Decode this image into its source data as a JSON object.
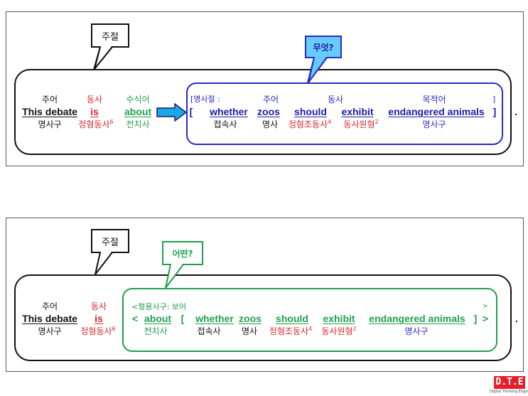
{
  "colors": {
    "black": "#111111",
    "red": "#d9262c",
    "green": "#1fa14b",
    "blue": "#2a2ac4",
    "callout_blue_fill": "#66ccff",
    "arrow_fill": "#1aa7e8",
    "logo_red": "#e3202a"
  },
  "panel1": {
    "callout_main": "주절",
    "callout_question": "무엇?",
    "main": [
      {
        "top": "주어",
        "word": "This debate",
        "bottom": "명사구",
        "color": "black"
      },
      {
        "top": "동사",
        "word": "is",
        "bottom": "정형동사",
        "bottom_sup": "6",
        "color": "red"
      },
      {
        "top": "수식어",
        "word": "about",
        "bottom": "전치사",
        "color": "green"
      }
    ],
    "arrow_icon": "right-arrow-icon",
    "clause_header": "[명사절 :",
    "clause_header_end": "]",
    "clause_open": "[",
    "clause_close": "]",
    "clause": [
      {
        "top": "",
        "word": "whether",
        "bottom": "접속사",
        "bottom_color": "black"
      },
      {
        "top": "주어",
        "word": "zoos",
        "bottom": "명사",
        "bottom_color": "black"
      },
      {
        "top": "",
        "word": "should",
        "bottom": "정형조동사",
        "bottom_sup": "4",
        "bottom_color": "red"
      },
      {
        "top": "동사",
        "word": "exhibit",
        "bottom": "동사원형",
        "bottom_sup": "2",
        "bottom_color": "red"
      },
      {
        "top": "목적어",
        "word": "endangered animals",
        "bottom": "명사구",
        "bottom_color": "blue"
      }
    ],
    "period": "."
  },
  "panel2": {
    "callout_main": "주절",
    "callout_question": "어떤?",
    "main": [
      {
        "top": "주어",
        "word": "This debate",
        "bottom": "명사구",
        "color": "black"
      },
      {
        "top": "동사",
        "word": "is",
        "bottom": "정형동사",
        "bottom_sup": "6",
        "color": "red"
      }
    ],
    "phrase_header": "<형용사구: 보어",
    "phrase_header_end": ">",
    "phrase_open": "<",
    "phrase_close": ">",
    "bracket_open": "[",
    "bracket_close": "]",
    "phrase": [
      {
        "word": "about",
        "bottom": "전치사",
        "bottom_color": "green"
      },
      {
        "word": "whether",
        "bottom": "접속사",
        "bottom_color": "black"
      },
      {
        "word": "zoos",
        "bottom": "명사",
        "bottom_color": "black"
      },
      {
        "word": "should",
        "bottom": "정형조동사",
        "bottom_sup": "4",
        "bottom_color": "red"
      },
      {
        "word": "exhibit",
        "bottom": "동사원형",
        "bottom_sup": "2",
        "bottom_color": "red"
      },
      {
        "word": "endangered animals",
        "bottom": "명사구",
        "bottom_color": "blue"
      }
    ],
    "period": "."
  },
  "logo": {
    "mark": "D.T.E",
    "caption": "Digital Thinking English"
  }
}
